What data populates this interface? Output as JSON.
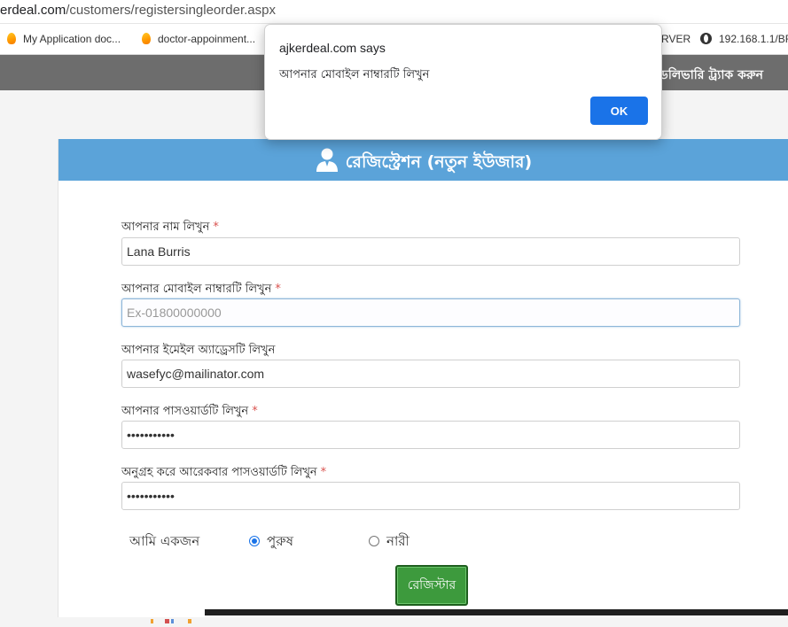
{
  "browser": {
    "url_host": "erdeal.com",
    "url_path": "/customers/registersingleorder.aspx",
    "bookmarks": [
      {
        "label": "My Application doc..."
      },
      {
        "label": "doctor-appoinment..."
      },
      {
        "label": "RVER"
      },
      {
        "label": "192.168.1.1/BR"
      }
    ]
  },
  "site_nav": {
    "track_delivery": "ডেলিভারি ট্র্যাক করুন"
  },
  "dialog": {
    "title": "ajkerdeal.com says",
    "message": "আপনার মোবাইল নাম্বারটি লিখুন",
    "ok_label": "OK"
  },
  "registration": {
    "title": "রেজিস্ট্রেশন (নতুন ইউজার)",
    "required_marker": "*",
    "fields": {
      "name": {
        "label": "আপনার নাম লিখুন",
        "value": "Lana Burris"
      },
      "mobile": {
        "label": "আপনার মোবাইল নাম্বারটি লিখুন",
        "value": "",
        "placeholder": "Ex-01800000000"
      },
      "email": {
        "label": "আপনার ইমেইল অ্যাড্রেসটি লিখুন",
        "value": "wasefyc@mailinator.com"
      },
      "password": {
        "label": "আপনার পাসওয়ার্ডটি লিখুন",
        "value": "•••••••••••"
      },
      "confirm_password": {
        "label": "অনুগ্রহ করে আরেকবার পাসওয়ার্ডটি লিখুন",
        "value": "•••••••••••"
      }
    },
    "gender": {
      "label": "আমি একজন",
      "options": [
        {
          "label": "পুরুষ",
          "selected": true
        },
        {
          "label": "নারী",
          "selected": false
        }
      ]
    },
    "submit_label": "রেজিস্টার"
  },
  "colors": {
    "header_blue": "#5ba3d9",
    "nav_gray": "#6d6d6d",
    "submit_green": "#3d9a3d",
    "ok_blue": "#1a73e8",
    "required_red": "#d9534f"
  }
}
